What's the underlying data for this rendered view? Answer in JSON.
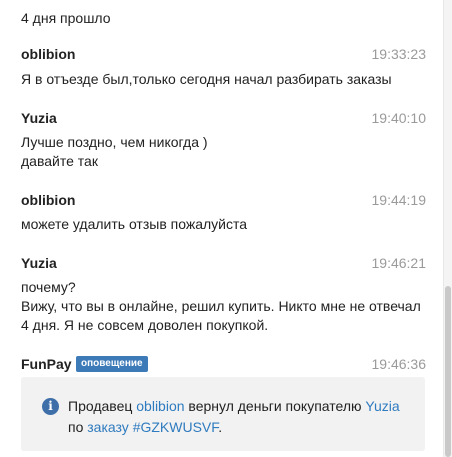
{
  "messages": [
    {
      "line": "4 дня прошло"
    },
    {
      "author": "oblibion",
      "time": "19:33:23",
      "lines": [
        "Я в отъезде был,только сегодня начал разбирать заказы"
      ]
    },
    {
      "author": "Yuzia",
      "time": "19:40:10",
      "lines": [
        "Лучше поздно, чем никогда )",
        "давайте так"
      ]
    },
    {
      "author": "oblibion",
      "time": "19:44:19",
      "lines": [
        "можете удалить отзыв пожалуйста"
      ]
    },
    {
      "author": "Yuzia",
      "time": "19:46:21",
      "lines": [
        "почему?",
        "Вижу, что вы в онлайне, решил купить. Никто мне не отвечал",
        "4 дня. Я не совсем доволен покупкой."
      ]
    },
    {
      "author": "FunPay",
      "badge": "оповещение",
      "time": "19:46:36"
    }
  ],
  "notice": {
    "icon": "info-icon",
    "seller_prefix": "Продавец ",
    "seller": "oblibion",
    "mid": " вернул деньги покупателю ",
    "buyer": "Yuzia",
    "line2_prefix": "по ",
    "order_word": "заказу",
    "order_id": "#GZKWUSVF",
    "suffix": "."
  },
  "colors": {
    "link": "#2f7bbf",
    "badge": "#3d7ab8",
    "notice_bg": "#f2f2f2",
    "time": "#9a9a9a"
  }
}
